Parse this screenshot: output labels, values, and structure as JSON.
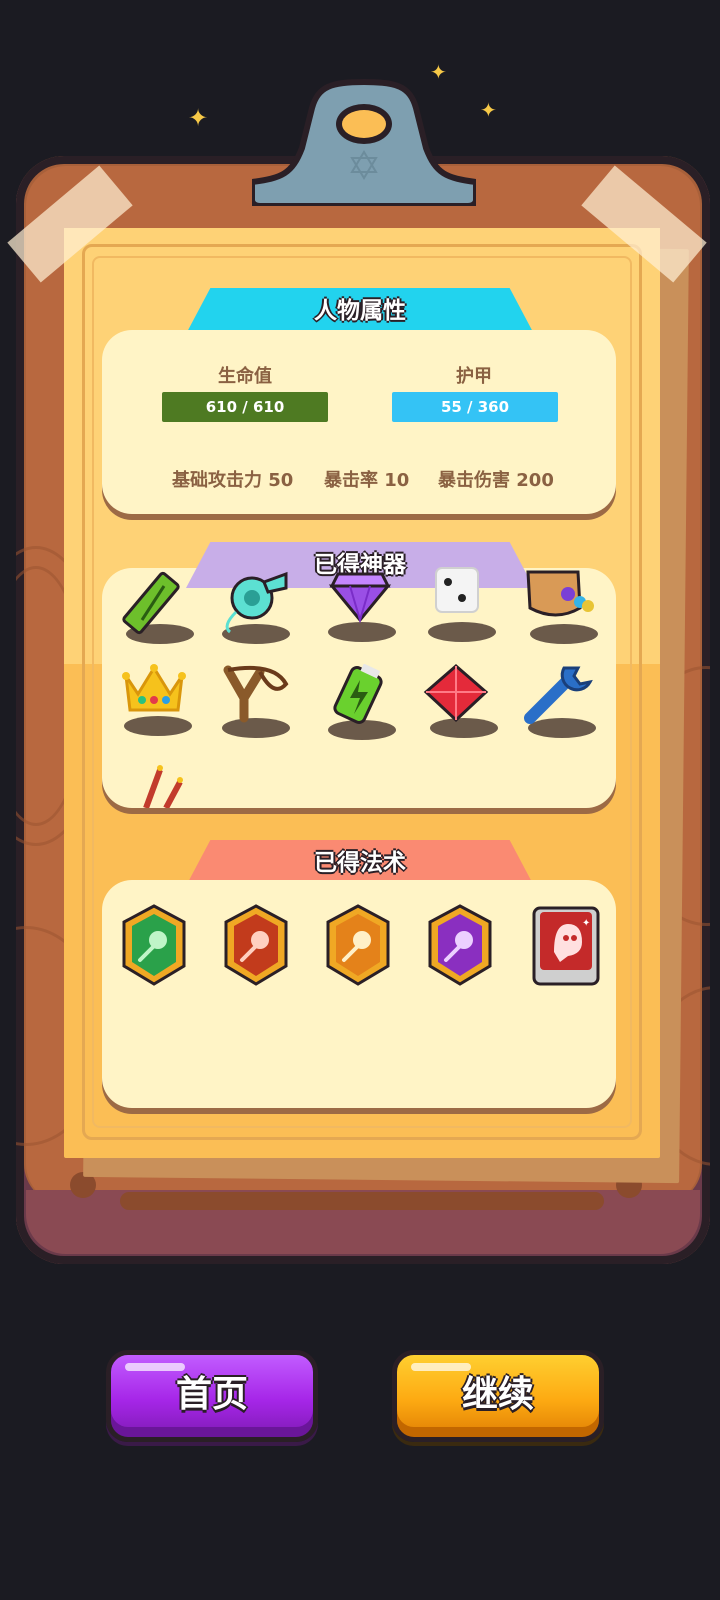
{
  "character": {
    "title": "人物属性",
    "hp": {
      "label": "生命值",
      "value": "610 / 610",
      "current": 610,
      "max": 610,
      "color": "#4e7a22"
    },
    "armor": {
      "label": "护甲",
      "value": "55 / 360",
      "current": 55,
      "max": 360,
      "color": "#34c3f5"
    },
    "attributes": [
      {
        "label": "基础攻击力 50"
      },
      {
        "label": "暴击率 10"
      },
      {
        "label": "暴击伤害 200"
      }
    ]
  },
  "artifacts": {
    "title": "已得神器",
    "items": [
      {
        "icon": "green-ruler-icon"
      },
      {
        "icon": "whistle-icon"
      },
      {
        "icon": "purple-diamond-icon"
      },
      {
        "icon": "dice-icon"
      },
      {
        "icon": "gem-bag-icon"
      },
      {
        "icon": "crown-icon"
      },
      {
        "icon": "slingshot-icon"
      },
      {
        "icon": "battery-icon"
      },
      {
        "icon": "red-gem-icon"
      },
      {
        "icon": "wrench-icon"
      },
      {
        "icon": "firecracker-icon"
      }
    ]
  },
  "spells": {
    "title": "已得法术",
    "items": [
      {
        "icon": "green-comet-badge-icon",
        "color": "#2aa14a"
      },
      {
        "icon": "red-comet-badge-icon",
        "color": "#c23b1c"
      },
      {
        "icon": "orange-comet-badge-icon",
        "color": "#e4821a"
      },
      {
        "icon": "purple-comet-badge-icon",
        "color": "#8a2fc0"
      },
      {
        "icon": "ghost-card-icon",
        "color": "#c42a2a"
      }
    ]
  },
  "buttons": {
    "home": "首页",
    "continue": "继续"
  },
  "colors": {
    "character_tab": "#22d3ee",
    "artifacts_tab": "#c8aee8",
    "spells_tab": "#fa8a72",
    "home_button": "#a626e8",
    "continue_button": "#fdaa12"
  }
}
